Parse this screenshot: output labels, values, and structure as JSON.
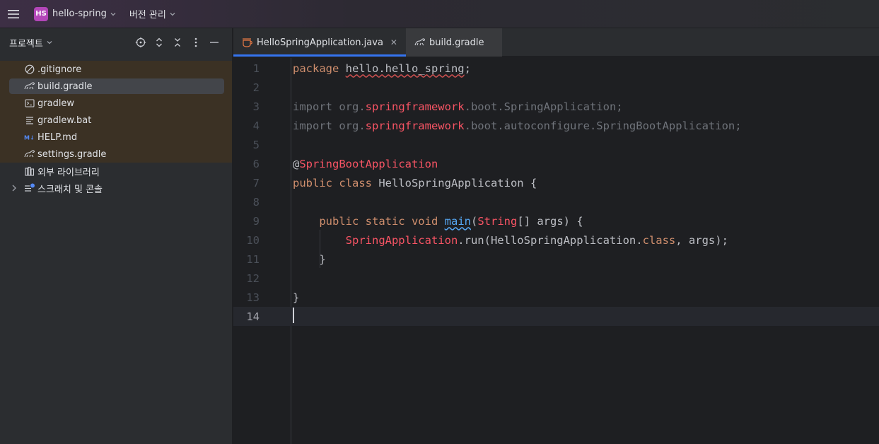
{
  "titlebar": {
    "project_badge": "HS",
    "project_name": "hello-spring",
    "vcs_label": "버전 관리"
  },
  "sidebar": {
    "title": "프로젝트",
    "items": [
      {
        "label": ".gitignore",
        "icon": "ignored-file-icon"
      },
      {
        "label": "build.gradle",
        "icon": "gradle-icon"
      },
      {
        "label": "gradlew",
        "icon": "terminal-file-icon"
      },
      {
        "label": "gradlew.bat",
        "icon": "text-file-icon"
      },
      {
        "label": "HELP.md",
        "icon": "markdown-icon"
      },
      {
        "label": "settings.gradle",
        "icon": "gradle-icon"
      },
      {
        "label": "외부 라이브러리",
        "icon": "library-icon"
      },
      {
        "label": "스크래치 및 콘솔",
        "icon": "scratches-icon"
      }
    ]
  },
  "tabs": [
    {
      "label": "HelloSpringApplication.java",
      "icon": "java-icon"
    },
    {
      "label": "build.gradle",
      "icon": "gradle-icon"
    }
  ],
  "editor": {
    "line_numbers": [
      "1",
      "2",
      "3",
      "4",
      "5",
      "6",
      "7",
      "8",
      "9",
      "10",
      "11",
      "12",
      "13",
      "14"
    ],
    "current_line": 14
  },
  "colors": {
    "accent": "#3574f0",
    "keyword": "#cf8e6d",
    "spring_ref": "#f75464",
    "function": "#56a8f5",
    "badge": "#b346b8"
  }
}
